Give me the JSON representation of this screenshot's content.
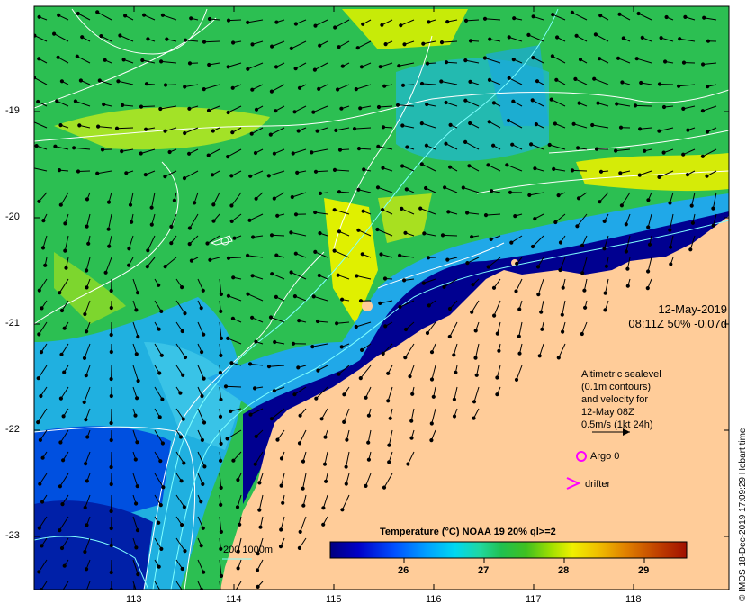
{
  "map": {
    "lat_axis": {
      "ticks": [
        -19,
        -20,
        -21,
        -22,
        -23
      ]
    },
    "lon_axis": {
      "ticks": [
        113,
        114,
        115,
        116,
        117,
        118
      ]
    },
    "date": "12-May-2019",
    "time_info": "08:11Z  50% -0.07d",
    "altimetry_note": [
      "Altimetric sealevel",
      "(0.1m contours)",
      "and velocity for",
      "12-May 08Z",
      "0.5m/s (1kt 24h)"
    ],
    "argo_label": "Argo 0",
    "drifter_label": "drifter",
    "isobath_label": "200  1000m",
    "credit": "© IMOS 18-Dec-2019 17:09:29 Hobart time",
    "colorbar": {
      "title": "Temperature (°C) NOAA 19 20% ql>=2",
      "ticks": [
        "26",
        "27",
        "28",
        "29"
      ],
      "colors": [
        "#000080",
        "#0000c8",
        "#0050ff",
        "#00a0ff",
        "#00d8f0",
        "#20d8a0",
        "#20c050",
        "#40c020",
        "#a0e000",
        "#f0f000",
        "#f0c000",
        "#e08000",
        "#c04000",
        "#a01000"
      ]
    },
    "colors": {
      "land": "#ffcc99",
      "warm_yellow": "#e8f000",
      "green": "#28c850",
      "cyan": "#20b8e0",
      "deep_blue": "#000088",
      "contour": "#ffffff",
      "isobath": "#80ffff",
      "argo": "#ff00ff"
    }
  }
}
